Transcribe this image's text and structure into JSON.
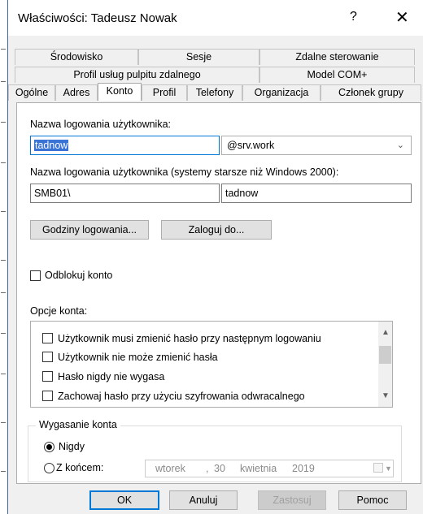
{
  "window": {
    "title": "Właściwości: Tadeusz Nowak",
    "help": "?",
    "close": "✕"
  },
  "tabs_row1": [
    "Środowisko",
    "Sesje",
    "Zdalne sterowanie"
  ],
  "tabs_row2": [
    "Profil usług pulpitu zdalnego",
    "Model COM+"
  ],
  "tabs_row3": [
    "Ogólne",
    "Adres",
    "Konto",
    "Profil",
    "Telefony",
    "Organizacja",
    "Członek grupy"
  ],
  "active_tab": "Konto",
  "account": {
    "logon_label": "Nazwa logowania użytkownika:",
    "logon_value": "tadnow",
    "domain_value": "@srv.work",
    "legacy_label": "Nazwa logowania użytkownika (systemy starsze niż Windows 2000):",
    "legacy_domain": "SMB01\\",
    "legacy_user": "tadnow",
    "logon_hours_button": "Godziny logowania...",
    "logon_to_button": "Zaloguj do...",
    "unlock_label": "Odblokuj konto",
    "options_label": "Opcje konta:",
    "options": [
      "Użytkownik musi zmienić hasło przy następnym logowaniu",
      "Użytkownik nie może zmienić hasła",
      "Hasło nigdy nie wygasa",
      "Zachowaj hasło przy użyciu szyfrowania odwracalnego"
    ],
    "expiry_label": "Wygasanie konta",
    "never_label": "Nigdy",
    "end_label": "Z końcem:",
    "date": {
      "weekday": "wtorek",
      "sep": ",",
      "day": "30",
      "month": "kwietnia",
      "year": "2019"
    }
  },
  "footer": {
    "ok": "OK",
    "cancel": "Anuluj",
    "apply": "Zastosuj",
    "help": "Pomoc"
  },
  "colors": {
    "accent": "#0078d7",
    "selection": "#3a73d6"
  }
}
